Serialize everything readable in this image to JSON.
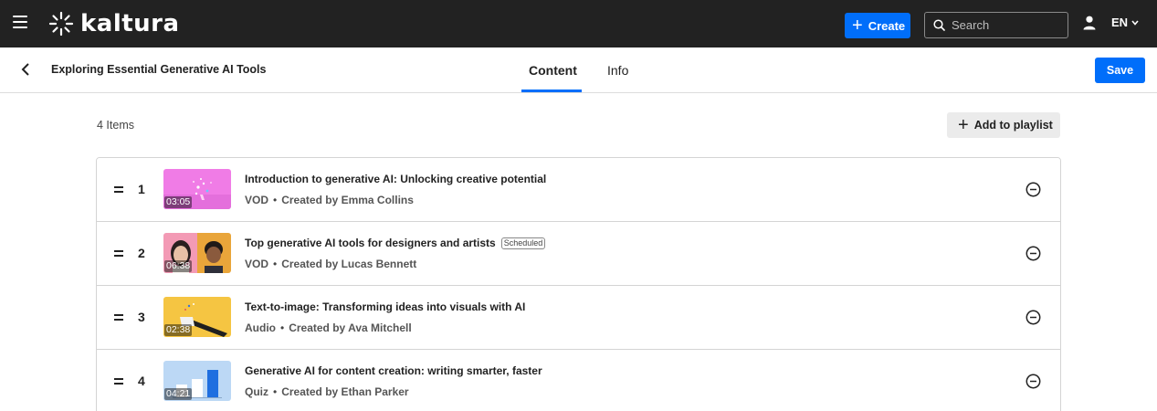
{
  "topbar": {
    "logo_text": "kaltura",
    "create_label": "Create",
    "search_placeholder": "Search",
    "language": "EN"
  },
  "subheader": {
    "page_title": "Exploring Essential Generative AI Tools",
    "tabs": [
      {
        "label": "Content",
        "active": true
      },
      {
        "label": "Info",
        "active": false
      }
    ],
    "save_label": "Save"
  },
  "playlist": {
    "items_count": "4 Items",
    "add_label": "Add to playlist",
    "items": [
      {
        "index": "1",
        "title": "Introduction to generative AI: Unlocking creative potential",
        "badge": "",
        "type": "VOD",
        "created_by": "Created by Emma Collins",
        "duration": "03:05"
      },
      {
        "index": "2",
        "title": "Top generative AI tools for designers and artists",
        "badge": "Scheduled",
        "type": "VOD",
        "created_by": "Created by Lucas Bennett",
        "duration": "06:38"
      },
      {
        "index": "3",
        "title": "Text-to-image: Transforming ideas into visuals with AI",
        "badge": "",
        "type": "Audio",
        "created_by": "Created by Ava Mitchell",
        "duration": "02:38"
      },
      {
        "index": "4",
        "title": "Generative AI for content creation: writing smarter, faster",
        "badge": "",
        "type": "Quiz",
        "created_by": "Created by Ethan Parker",
        "duration": "04:21"
      }
    ]
  },
  "colors": {
    "accent": "#006efa",
    "topbar": "#222222"
  }
}
